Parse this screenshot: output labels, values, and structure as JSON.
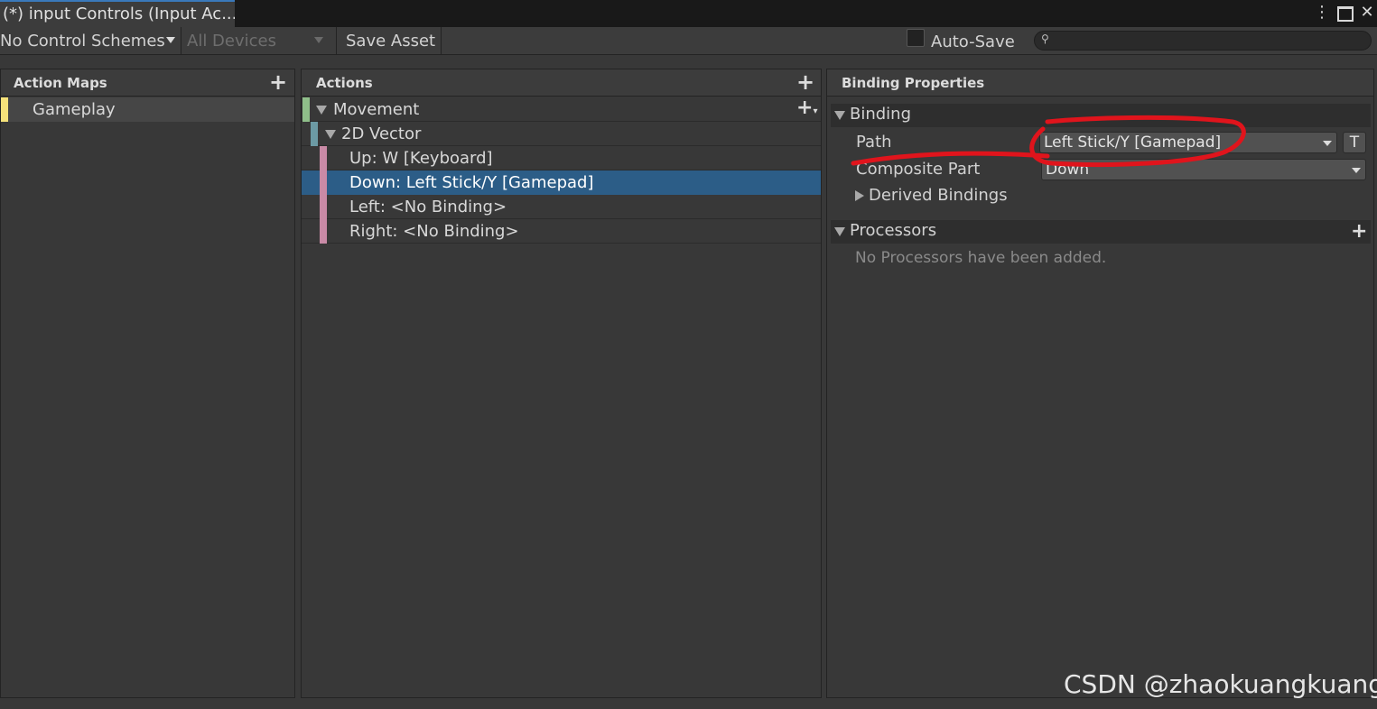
{
  "window": {
    "tab_title": "(*) input Controls (Input Ac...",
    "menu_icon": "kebab-menu-icon",
    "maximize_icon": "maximize-icon",
    "close_icon": "close-icon"
  },
  "toolbar": {
    "control_schemes": "No Control Schemes",
    "devices": "All Devices",
    "save_asset": "Save Asset",
    "auto_save_label": "Auto-Save",
    "auto_save_checked": false,
    "search_value": ""
  },
  "action_maps": {
    "header": "Action Maps",
    "items": [
      {
        "label": "Gameplay",
        "color": "#f6e27a",
        "selected": true
      }
    ]
  },
  "actions": {
    "header": "Actions",
    "rows": [
      {
        "label": "Movement",
        "color": "#8fbf8a",
        "level": 0,
        "expanded": true
      },
      {
        "label": "2D Vector",
        "color": "#6c9aa4",
        "level": 1,
        "expanded": true
      },
      {
        "label": "Up: W [Keyboard]",
        "color": "#c98aa6",
        "level": 2,
        "selected": false
      },
      {
        "label": "Down: Left Stick/Y [Gamepad]",
        "color": "#c98aa6",
        "level": 2,
        "selected": true
      },
      {
        "label": "Left: <No Binding>",
        "color": "#c98aa6",
        "level": 2,
        "selected": false
      },
      {
        "label": "Right: <No Binding>",
        "color": "#c98aa6",
        "level": 2,
        "selected": false
      }
    ]
  },
  "binding_properties": {
    "header": "Binding Properties",
    "binding_section": "Binding",
    "path_label": "Path",
    "path_value": "Left Stick/Y [Gamepad]",
    "t_button": "T",
    "composite_part_label": "Composite Part",
    "composite_part_value": "Down",
    "derived_bindings": "Derived Bindings",
    "processors_section": "Processors",
    "processors_empty": "No Processors have been added."
  },
  "watermark": "CSDN @zhaokuangkuang_",
  "colors": {
    "selection": "#2c5d87",
    "annotation": "#e0141c"
  }
}
